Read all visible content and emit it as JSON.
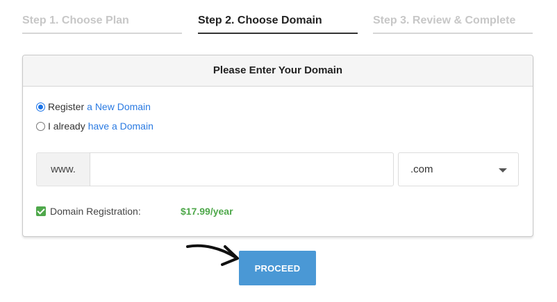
{
  "steps": [
    {
      "label": "Step 1. Choose Plan",
      "state": "inactive"
    },
    {
      "label": "Step 2. Choose Domain",
      "state": "active"
    },
    {
      "label": "Step 3. Review & Complete",
      "state": "inactive"
    }
  ],
  "card": {
    "title": "Please Enter Your Domain",
    "options": [
      {
        "prefix": "Register",
        "link": "a New Domain",
        "selected": true
      },
      {
        "prefix": "I already",
        "link": "have a Domain",
        "selected": false
      }
    ],
    "www_prefix": "www.",
    "domain_value": "",
    "tld_selected": ".com",
    "registration": {
      "label": "Domain Registration:",
      "price": "$17.99/year",
      "checked": true
    }
  },
  "proceed_label": "PROCEED",
  "colors": {
    "link": "#2a7ae2",
    "price": "#4fa84b",
    "button": "#4a98d5"
  }
}
